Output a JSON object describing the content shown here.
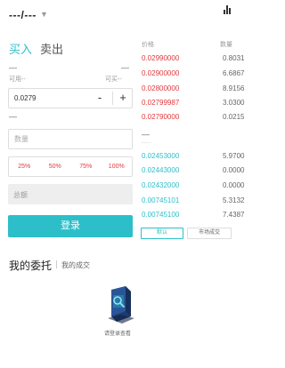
{
  "header": {
    "pair": "---/---",
    "pair_caret": "▼",
    "chart_icon": "bar-chart-icon"
  },
  "tabs": {
    "buy": "买入",
    "sell": "卖出"
  },
  "form": {
    "dash_left": "—",
    "dash_right": "—",
    "available_label": "可用--",
    "available_label_right": "可买--",
    "price_value": "0.0279",
    "minus_label": "-",
    "plus_label": "+",
    "mid_dash": "—",
    "qty_placeholder": "数量",
    "percents": [
      "25%",
      "50%",
      "75%",
      "100%"
    ],
    "total_label": "总额",
    "login_label": "登录"
  },
  "orderbook": {
    "head_price": "价格",
    "head_qty": "数量",
    "asks": [
      {
        "price": "0.02990000",
        "qty": "0.8031"
      },
      {
        "price": "0.02900000",
        "qty": "6.6867"
      },
      {
        "price": "0.02800000",
        "qty": "8.9156"
      },
      {
        "price": "0.02799987",
        "qty": "3.0300"
      },
      {
        "price": "0.02790000",
        "qty": "0.0215"
      }
    ],
    "mid_dash": "—",
    "mid_dots": "....",
    "bids": [
      {
        "price": "0.02453000",
        "qty": "5.9700"
      },
      {
        "price": "0.02443000",
        "qty": "0.0000"
      },
      {
        "price": "0.02432000",
        "qty": "0.0000"
      },
      {
        "price": "0.00745101",
        "qty": "5.3132"
      },
      {
        "price": "0.00745100",
        "qty": "7.4387"
      }
    ],
    "btn_default": "默认",
    "btn_market": "市场成交"
  },
  "orders": {
    "my_orders": "我的委托",
    "my_trades": "我的成交",
    "empty_text": "请登录查看",
    "empty_icon": "search-document-icon"
  },
  "colors": {
    "accent": "#2cbfc9",
    "sell": "#e4393c"
  }
}
